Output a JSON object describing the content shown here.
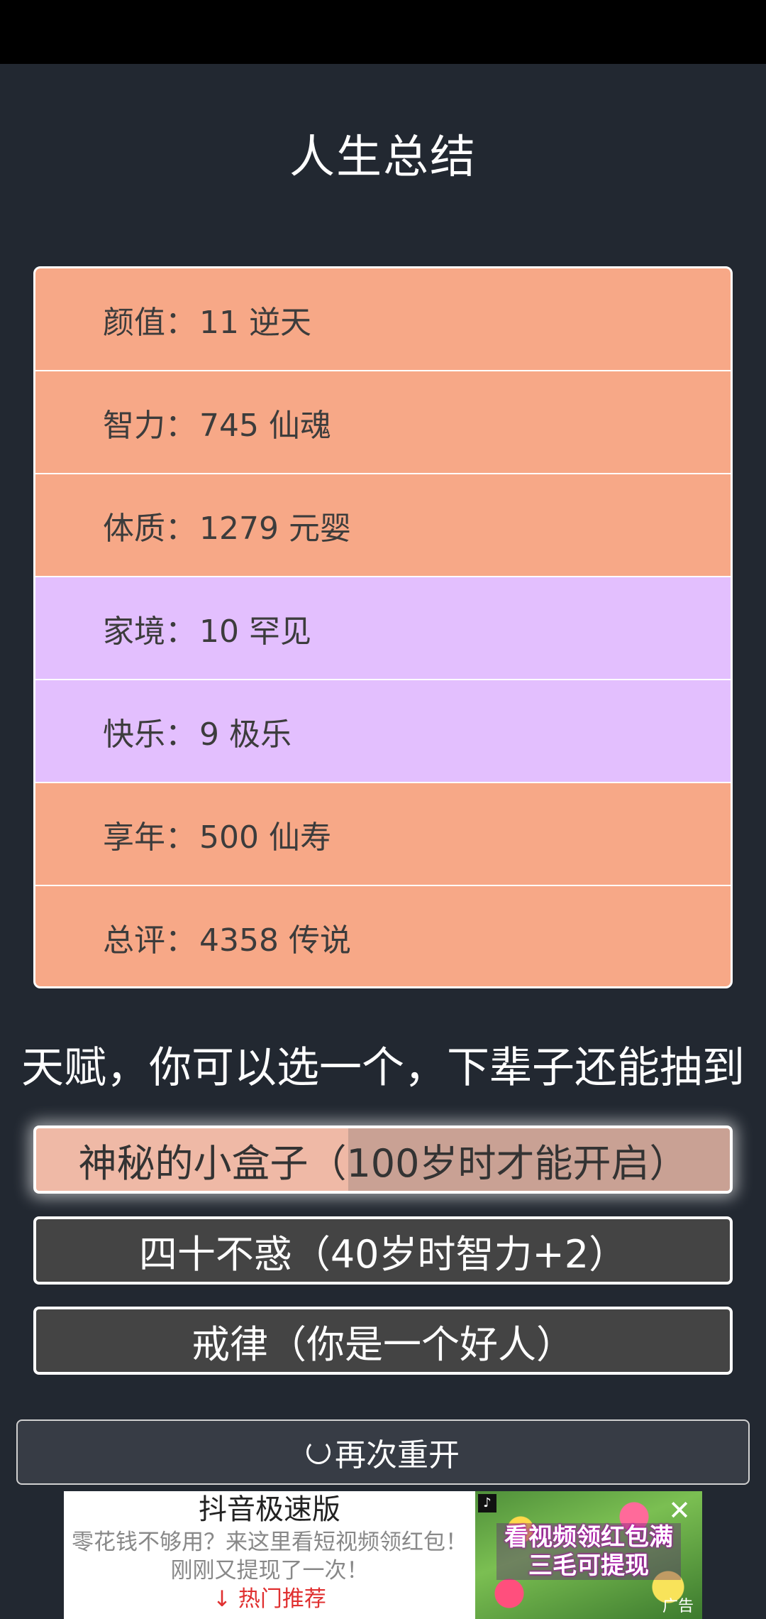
{
  "title": "人生总结",
  "stats": [
    {
      "label": "颜值：",
      "value": "11 逆天",
      "color": "#f7a887"
    },
    {
      "label": "智力：",
      "value": "745 仙魂",
      "color": "#f7a887"
    },
    {
      "label": "体质：",
      "value": "1279 元婴",
      "color": "#f7a887"
    },
    {
      "label": "家境：",
      "value": "10 罕见",
      "color": "#e3bffe"
    },
    {
      "label": "快乐：",
      "value": "9 极乐",
      "color": "#e3bffe"
    },
    {
      "label": "享年：",
      "value": "500 仙寿",
      "color": "#f7a887"
    },
    {
      "label": "总评：",
      "value": "4358 传说",
      "color": "#f7a887"
    }
  ],
  "talent_heading": "天赋，你可以选一个，下辈子还能抽到",
  "talents": [
    {
      "label": "神秘的小盒子（100岁时才能开启）",
      "selected": true
    },
    {
      "label": "四十不惑（40岁时智力+2）",
      "selected": false
    },
    {
      "label": "戒律（你是一个好人）",
      "selected": false
    }
  ],
  "restart_label": "再次重开",
  "ad": {
    "app_name": "抖音极速版",
    "description": "零花钱不够用？来这里看短视频领红包！刚刚又提现了一次！",
    "link": "热门推荐",
    "image_text": "看视频领红包满三毛可提现",
    "tag": "广告"
  }
}
